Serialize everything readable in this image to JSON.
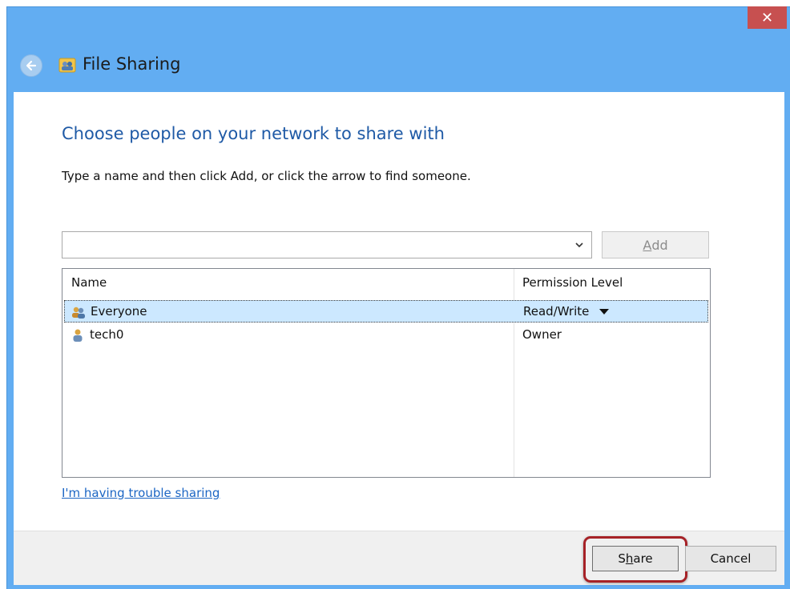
{
  "window": {
    "title": "File Sharing",
    "close_glyph": "✕"
  },
  "dialog": {
    "heading": "Choose people on your network to share with",
    "instructions": "Type a name and then click Add, or click the arrow to find someone.",
    "name_input": {
      "value": "",
      "placeholder": ""
    },
    "add_button": {
      "underlined": "A",
      "rest": "dd"
    },
    "columns": {
      "name": "Name",
      "permission": "Permission Level"
    },
    "rows": [
      {
        "name": "Everyone",
        "permission": "Read/Write",
        "icon": "group-icon",
        "selected": true
      },
      {
        "name": "tech0",
        "permission": "Owner",
        "icon": "user-icon",
        "selected": false
      }
    ],
    "help_link": "I'm having trouble sharing"
  },
  "footer": {
    "share_button": {
      "pre": "S",
      "underlined": "h",
      "rest": "are"
    },
    "cancel_button": "Cancel"
  },
  "colors": {
    "titlebar": "#62adf2",
    "close": "#c75050",
    "heading": "#1f5aa6",
    "link": "#1c66c4",
    "selection": "#cce8ff",
    "highlight_ring": "#a62227"
  }
}
